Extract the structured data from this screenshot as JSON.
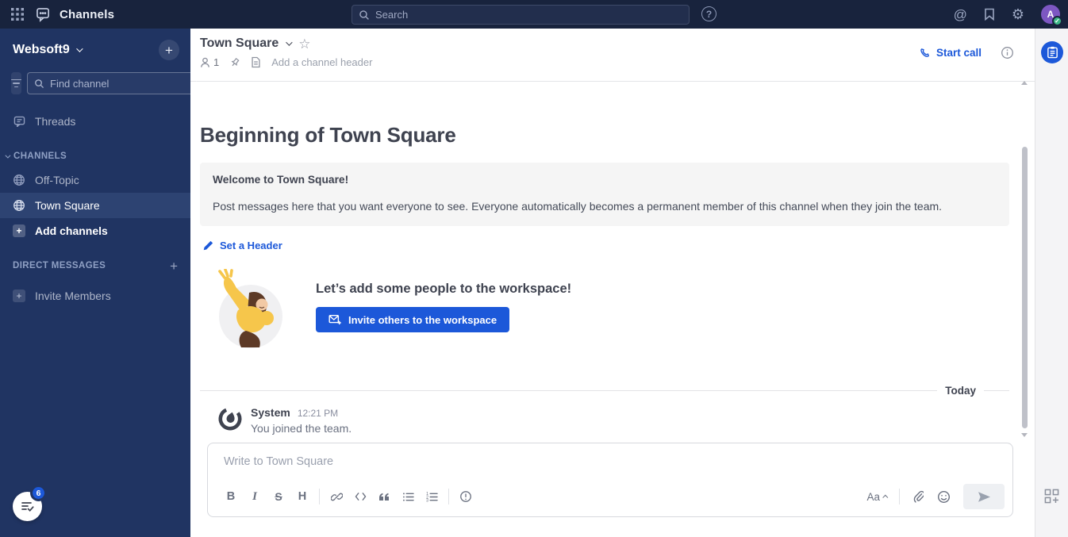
{
  "topbar": {
    "app_title": "Channels",
    "search_placeholder": "Search",
    "avatar_initial": "A"
  },
  "sidebar": {
    "team_name": "Websoft9",
    "find_channel_placeholder": "Find channel",
    "threads_label": "Threads",
    "channels_header": "CHANNELS",
    "channels": [
      {
        "label": "Off-Topic",
        "selected": false
      },
      {
        "label": "Town Square",
        "selected": true
      }
    ],
    "add_channels_label": "Add channels",
    "direct_messages_header": "DIRECT MESSAGES",
    "invite_members_label": "Invite Members",
    "checklist_badge_count": "6"
  },
  "channel_header": {
    "title": "Town Square",
    "member_count": "1",
    "add_header_placeholder": "Add a channel header",
    "start_call_label": "Start call"
  },
  "main": {
    "intro_heading": "Beginning of Town Square",
    "welcome_title": "Welcome to Town Square!",
    "welcome_body": "Post messages here that you want everyone to see. Everyone automatically becomes a permanent member of this channel when they join the team.",
    "set_header_label": "Set a Header",
    "invite_heading": "Let’s add some people to the workspace!",
    "invite_button_label": "Invite others to the workspace",
    "date_divider_label": "Today",
    "messages": [
      {
        "author": "System",
        "timestamp": "12:21 PM",
        "text": "You joined the team."
      }
    ]
  },
  "composer": {
    "placeholder": "Write to Town Square",
    "toolbar": {
      "bold": "B",
      "italic": "I",
      "strikethrough": "S",
      "heading": "H"
    },
    "format_toggle_label": "Aa"
  },
  "icons": {
    "settings_gear": "⚙",
    "star": "☆",
    "help": "?",
    "at_mention": "@",
    "plus": "+"
  },
  "colors": {
    "accent_blue": "#1c58d9",
    "topbar_bg": "#18233d",
    "sidebar_bg": "#203462",
    "sidebar_selected_bg": "#2d4372",
    "avatar_purple": "#7d57c2",
    "online_green": "#3db887",
    "right_strip_bg": "#f4f4f6",
    "welcome_box_bg": "#f5f5f5"
  }
}
